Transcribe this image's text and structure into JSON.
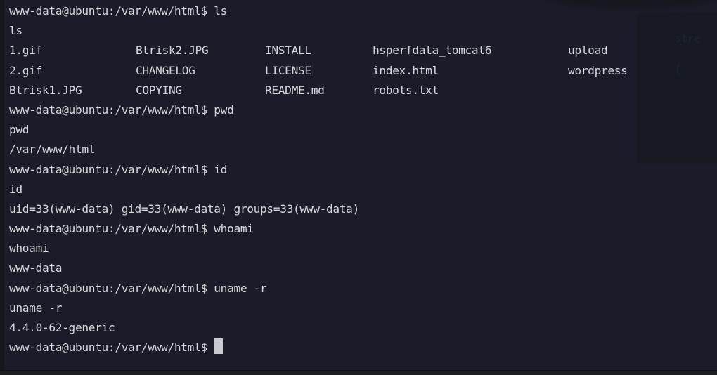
{
  "terminal": {
    "prompt": "www-data@ubuntu:/var/www/html$ ",
    "lines": [
      {
        "type": "command",
        "text": "ls"
      },
      {
        "type": "output",
        "text": "ls"
      },
      {
        "type": "ls-row",
        "cells": [
          "1.gif",
          "Btrisk2.JPG",
          "INSTALL",
          "hsperfdata_tomcat6",
          "upload"
        ]
      },
      {
        "type": "ls-row",
        "cells": [
          "2.gif",
          "CHANGELOG",
          "LICENSE",
          "index.html",
          "wordpress"
        ]
      },
      {
        "type": "ls-row",
        "cells": [
          "Btrisk1.JPG",
          "COPYING",
          "README.md",
          "robots.txt",
          ""
        ]
      },
      {
        "type": "command",
        "text": "pwd"
      },
      {
        "type": "output",
        "text": "pwd"
      },
      {
        "type": "output",
        "text": "/var/www/html"
      },
      {
        "type": "command",
        "text": "id"
      },
      {
        "type": "output",
        "text": "id"
      },
      {
        "type": "output",
        "text": "uid=33(www-data) gid=33(www-data) groups=33(www-data)"
      },
      {
        "type": "command",
        "text": "whoami"
      },
      {
        "type": "output",
        "text": "whoami"
      },
      {
        "type": "output",
        "text": "www-data"
      },
      {
        "type": "command",
        "text": "uname -r"
      },
      {
        "type": "output",
        "text": "uname -r"
      },
      {
        "type": "output",
        "text": "4.4.0-62-generic"
      },
      {
        "type": "current-prompt",
        "text": ""
      }
    ]
  },
  "background_window": {
    "visible_text": [
      "stre",
      "{"
    ]
  },
  "colors": {
    "background": "#1a1d29",
    "foreground": "#d6d6db",
    "cursor": "#c9cad0"
  }
}
